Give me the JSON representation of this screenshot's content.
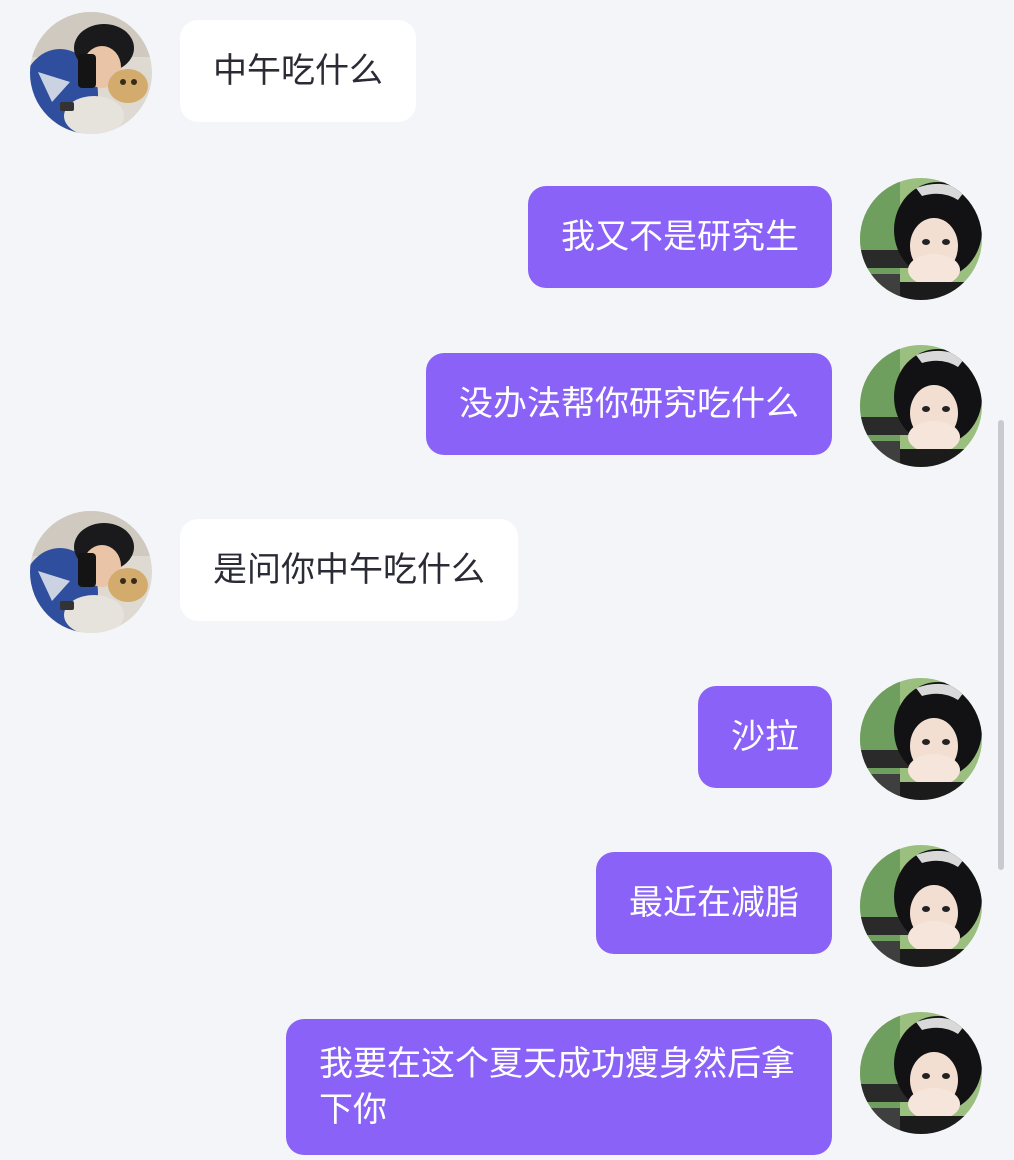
{
  "conversation": {
    "accent_color": "#8a62f7",
    "messages": [
      {
        "sender": "contact",
        "text": "中午吃什么"
      },
      {
        "sender": "self",
        "text": "我又不是研究生"
      },
      {
        "sender": "self",
        "text": "没办法帮你研究吃什么"
      },
      {
        "sender": "contact",
        "text": "是问你中午吃什么"
      },
      {
        "sender": "self",
        "text": "沙拉"
      },
      {
        "sender": "self",
        "text": "最近在减脂"
      },
      {
        "sender": "self",
        "text": "我要在这个夏天成功瘦身然后拿下你"
      }
    ]
  },
  "avatars": {
    "contact": "male-user-avatar",
    "self": "female-user-avatar"
  }
}
